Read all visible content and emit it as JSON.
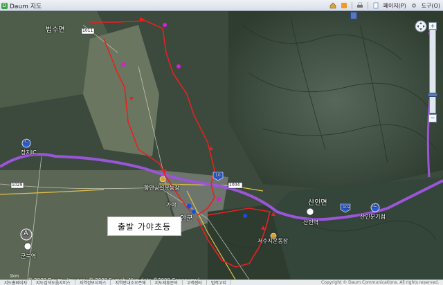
{
  "browser": {
    "tab_title": "Daum 지도",
    "page_menu": "페이지(P)",
    "tools_menu": "도구(O)"
  },
  "map": {
    "labels": {
      "beopsu": "법수면",
      "jangji": "장지IC",
      "ic_left": "IC",
      "haman_sports": "함안공설운동장",
      "gaya": "가야",
      "haman_gun": "안군",
      "sanin": "산인면",
      "sanin_station": "산인역",
      "sanin_junction": "산인분기점",
      "ic_right": "IC",
      "reservoir": "저수지운동장",
      "gunbuk": "군북역",
      "route_1029": "1029",
      "route_1011": "1011",
      "route_1004": "1004",
      "route_10": "10",
      "route_102": "102",
      "pin_a": "A"
    },
    "start_label": "출발 가야초등",
    "copyright": "© 2009 Daum · Imagery © 2009 Samah, Map data ©2009 Congnamul",
    "scale": "1km"
  },
  "footer": {
    "links": [
      "지도홈페이지",
      "지도검색도움서비스",
      "지역정보서비스",
      "지역안내소오픈해",
      "지도제휴문의",
      "고객센터",
      "법적고지"
    ],
    "copyright": "Copyright © Daum Communications. All rights reserved."
  },
  "colors": {
    "route": "#e82020",
    "highway": "#9a55d8",
    "waypoint": "#d61fd6"
  }
}
